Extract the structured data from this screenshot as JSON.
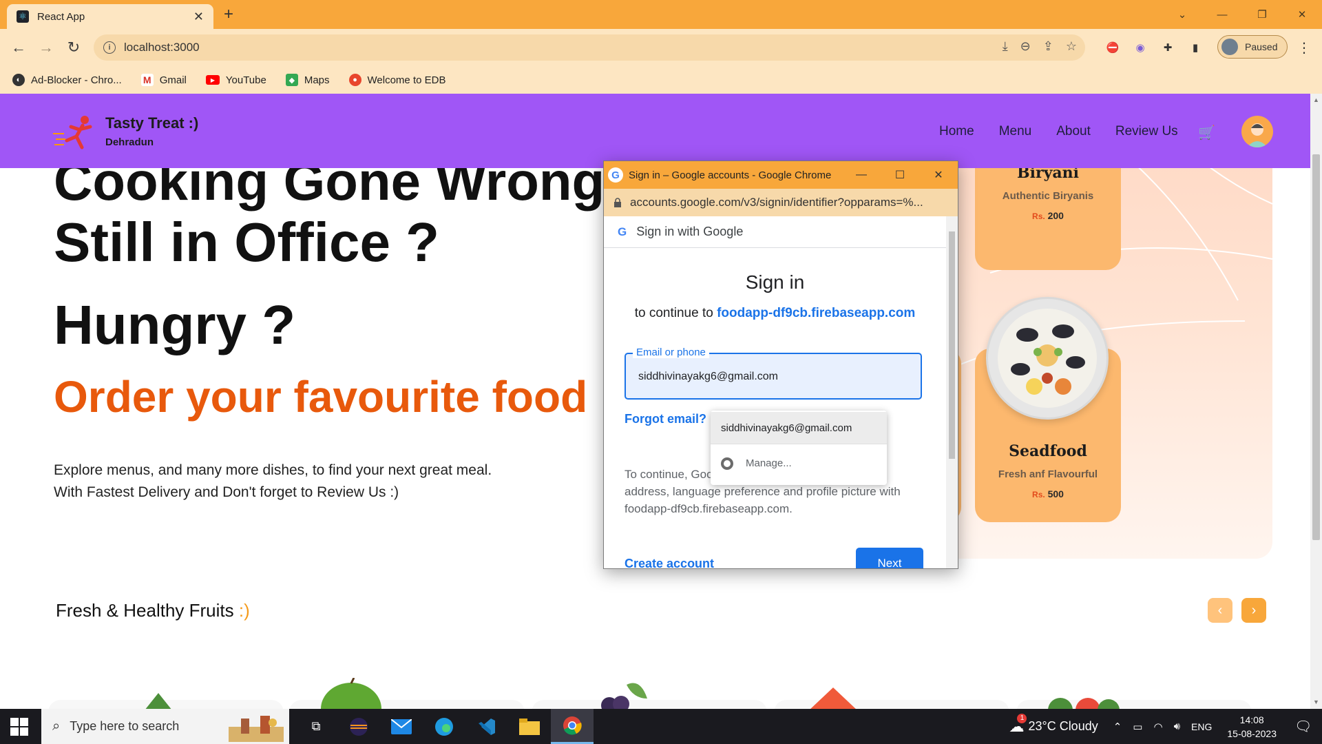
{
  "browser": {
    "tab_title": "React App",
    "url": "localhost:3000",
    "profile_status": "Paused",
    "bookmarks": [
      {
        "label": "Ad-Blocker - Chro...",
        "icon": "ad-blocker-icon",
        "color": "#333333"
      },
      {
        "label": "Gmail",
        "icon": "gmail-icon",
        "color": "#d93025"
      },
      {
        "label": "YouTube",
        "icon": "youtube-icon",
        "color": "#ff0000"
      },
      {
        "label": "Maps",
        "icon": "maps-icon",
        "color": "#34a853"
      },
      {
        "label": "Welcome to EDB",
        "icon": "edb-icon",
        "color": "#e8452c"
      }
    ]
  },
  "site": {
    "brand": "Tasty Treat :)",
    "city": "Dehradun",
    "nav": [
      "Home",
      "Menu",
      "About",
      "Review Us"
    ],
    "accent_color": "#a056f6"
  },
  "hero": {
    "cut_line": "Cooking Gone Wrong",
    "line1": "Still in Office ?",
    "line2": "Hungry ?",
    "order_line": "Order your favourite food :)",
    "desc_line1": "Explore menus, and many more dishes, to find your next great meal.",
    "desc_line2": "With Fastest Delivery and Don't forget to Review Us :)",
    "order_color": "#e8590c"
  },
  "dishes": [
    {
      "name": "Biryani",
      "subtitle": "Authentic Biryanis",
      "currency": "Rs.",
      "price": "200"
    },
    {
      "name": "Seadfood",
      "subtitle": "Fresh anf Flavourful",
      "currency": "Rs.",
      "price": "500"
    }
  ],
  "fruits_section": {
    "title": "Fresh & Healthy Fruits",
    "accent": ":)",
    "prev": "‹",
    "next": "›"
  },
  "popup": {
    "window_title": "Sign in – Google accounts - Google Chrome",
    "url": "accounts.google.com/v3/signin/identifier?opparams=%...",
    "header": "Sign in with Google",
    "heading": "Sign in",
    "continue_prefix": "to continue to",
    "app_name": "foodapp-df9cb.firebaseapp.com",
    "field_label": "Email or phone",
    "field_value": "siddhivinayakg6@gmail.com",
    "forgot": "Forgot email?",
    "note_line1": "To continue, Goo",
    "note_line2": "address, language preference and profile picture with",
    "note_line3": "foodapp-df9cb.firebaseapp.com.",
    "create_account": "Create account",
    "next_button": "Next",
    "autofill_suggestion": "siddhivinayakg6@gmail.com",
    "autofill_manage": "Manage..."
  },
  "taskbar": {
    "search_placeholder": "Type here to search",
    "weather_badge": "1",
    "weather": "23°C  Cloudy",
    "lang": "ENG",
    "time": "14:08",
    "date": "15-08-2023"
  }
}
